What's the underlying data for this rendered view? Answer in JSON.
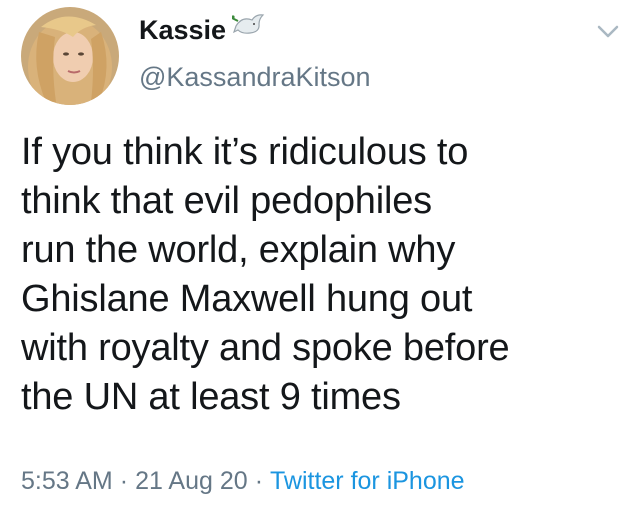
{
  "user": {
    "display_name": "Kassie",
    "handle": "@KassandraKitson"
  },
  "tweet": {
    "lines": [
      "If you think it’s ridiculous to",
      "think that evil pedophiles",
      "run the world, explain why",
      "Ghislane Maxwell hung out",
      "with royalty and spoke before",
      "the UN at least 9 times"
    ],
    "time": "5:53 AM",
    "date": "21 Aug 20",
    "source": "Twitter for iPhone",
    "separator": "·"
  },
  "icons": {
    "name_badge": "dove-icon",
    "menu": "chevron-down-icon"
  },
  "colors": {
    "text": "#14171a",
    "muted": "#657786",
    "link": "#1b95e0"
  }
}
